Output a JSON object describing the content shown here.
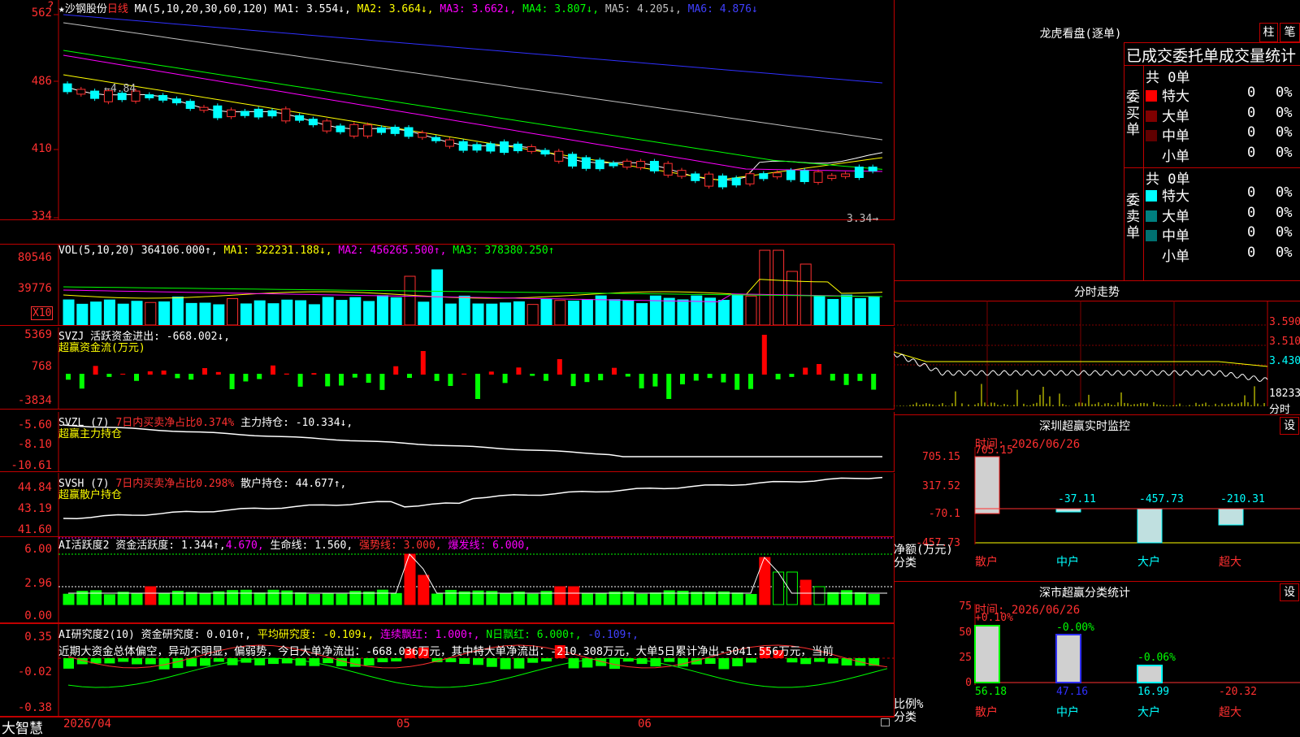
{
  "main": {
    "title": "★沙钢股份",
    "period": "日线",
    "ma_label": "MA(5,10,20,30,60,120)",
    "ma1": "MA1: 3.554↓,",
    "ma2": "MA2: 3.664↓,",
    "ma3": "MA3: 3.662↓,",
    "ma4": "MA4: 3.807↓,",
    "ma5": "MA5: 4.205↓,",
    "ma6": "MA6: 4.876↓",
    "yticks": [
      "562",
      "486",
      "410",
      "334"
    ],
    "high_note": "4.84",
    "low_note": "3.34",
    "icon": "question-icon"
  },
  "vol": {
    "label": "VOL(5,10,20)",
    "value": "364106.000↑,",
    "ma1": "MA1: 322231.188↓,",
    "ma2": "MA2: 456265.500↑,",
    "ma3": "MA3: 378380.250↑",
    "yticks": [
      "80546",
      "39776"
    ],
    "unit": "X10"
  },
  "svzj": {
    "label": "SVZJ  活跃资金进出: -668.002↓,",
    "sub": "超赢资金流(万元)",
    "yticks": [
      "5369",
      "768",
      "-3834"
    ]
  },
  "svzl": {
    "label1": "SVZL (7)",
    "label2": "7日内买卖净占比0.374%",
    "label3": "主力持仓: -10.334↓,",
    "sub": "超赢主力持仓",
    "yticks": [
      "-5.60",
      "-8.10",
      "-10.61"
    ]
  },
  "svsh": {
    "label1": "SVSH (7)",
    "label2": "7日内买卖净占比0.298%",
    "label3": "散户持仓: 44.677↑,",
    "sub": "超赢散户持仓",
    "yticks": [
      "44.84",
      "43.19",
      "41.60"
    ]
  },
  "ai1": {
    "label1": "AI活跃度2 资金活跃度: 1.344↑,",
    "label2": "4.670,",
    "label3": "生命线: 1.560,",
    "label4": "强势线: 3.000,",
    "label5": "爆发线: 6.000,",
    "yticks": [
      "6.00",
      "2.96",
      "0.00"
    ]
  },
  "ai2": {
    "label1": "AI研究度2(10) 资金研究度: 0.010↑,",
    "label2": "平均研究度: -0.109↓,",
    "label3": "连续飘红: 1.000↑,",
    "label4": "N日飘红: 6.000↑,",
    "label5": "-0.109↑,",
    "text": "近期大资金总体偏空，异动不明显，偏弱势，今日大单净流出：-668.036万元，其中特大单净流出：-210.308万元，大单5日累计净出-5041.556万元，当前",
    "yticks": [
      "0.35",
      "-0.02",
      "-0.38"
    ]
  },
  "xaxis": {
    "labels": [
      "2026/04",
      "05",
      "06"
    ],
    "brand": "大智慧"
  },
  "lhb": {
    "title": "龙虎看盘(逐单)",
    "btn1": "柱",
    "btn2": "笔",
    "header": "已成交委托单成交量统计",
    "buy_label": "委买单",
    "sell_label": "委卖单",
    "buy_total": "共 0单",
    "sell_total": "共 0单",
    "buy_rows": [
      {
        "name": "特大",
        "count": "0",
        "pct": "0%",
        "color": "#ff0000"
      },
      {
        "name": "大单",
        "count": "0",
        "pct": "0%",
        "color": "#800000"
      },
      {
        "name": "中单",
        "count": "0",
        "pct": "0%",
        "color": "#600000"
      },
      {
        "name": "小单",
        "count": "0",
        "pct": "0%",
        "color": "#000000"
      }
    ],
    "sell_rows": [
      {
        "name": "特大",
        "count": "0",
        "pct": "0%",
        "color": "#00ffff"
      },
      {
        "name": "大单",
        "count": "0",
        "pct": "0%",
        "color": "#008080"
      },
      {
        "name": "中单",
        "count": "0",
        "pct": "0%",
        "color": "#007070"
      },
      {
        "name": "小单",
        "count": "0",
        "pct": "0%",
        "color": "#000000"
      }
    ]
  },
  "fenshi": {
    "title": "分时走势",
    "prices": [
      "3.590",
      "3.510",
      "3.430"
    ],
    "vol_label": "18233",
    "vol_unit": "分时"
  },
  "monitor": {
    "title": "深圳超赢实时监控",
    "btn": "设",
    "time": "时间: 2026/06/26",
    "yticks": [
      "705.15",
      "317.52",
      "-70.1",
      "-457.73"
    ],
    "ylabel": "净额(万元)",
    "ylabel2": "分类",
    "categories": [
      "散户",
      "中户",
      "大户",
      "超大"
    ],
    "values": [
      "705.15",
      "-37.11",
      "-457.73",
      "-210.31"
    ]
  },
  "classify": {
    "title": "深市超赢分类统计",
    "btn": "设",
    "time": "时间: 2026/06/26",
    "yticks": [
      "75",
      "50",
      "25",
      "0"
    ],
    "ylabel": "比例%",
    "ylabel2": "分类",
    "categories": [
      "散户",
      "中户",
      "大户",
      "超大"
    ],
    "top_labels": [
      "+0.10%",
      "-0.00%",
      "-0.06%",
      ""
    ],
    "bottom_labels": [
      "56.18",
      "47.16",
      "16.99",
      "-20.32"
    ]
  }
}
